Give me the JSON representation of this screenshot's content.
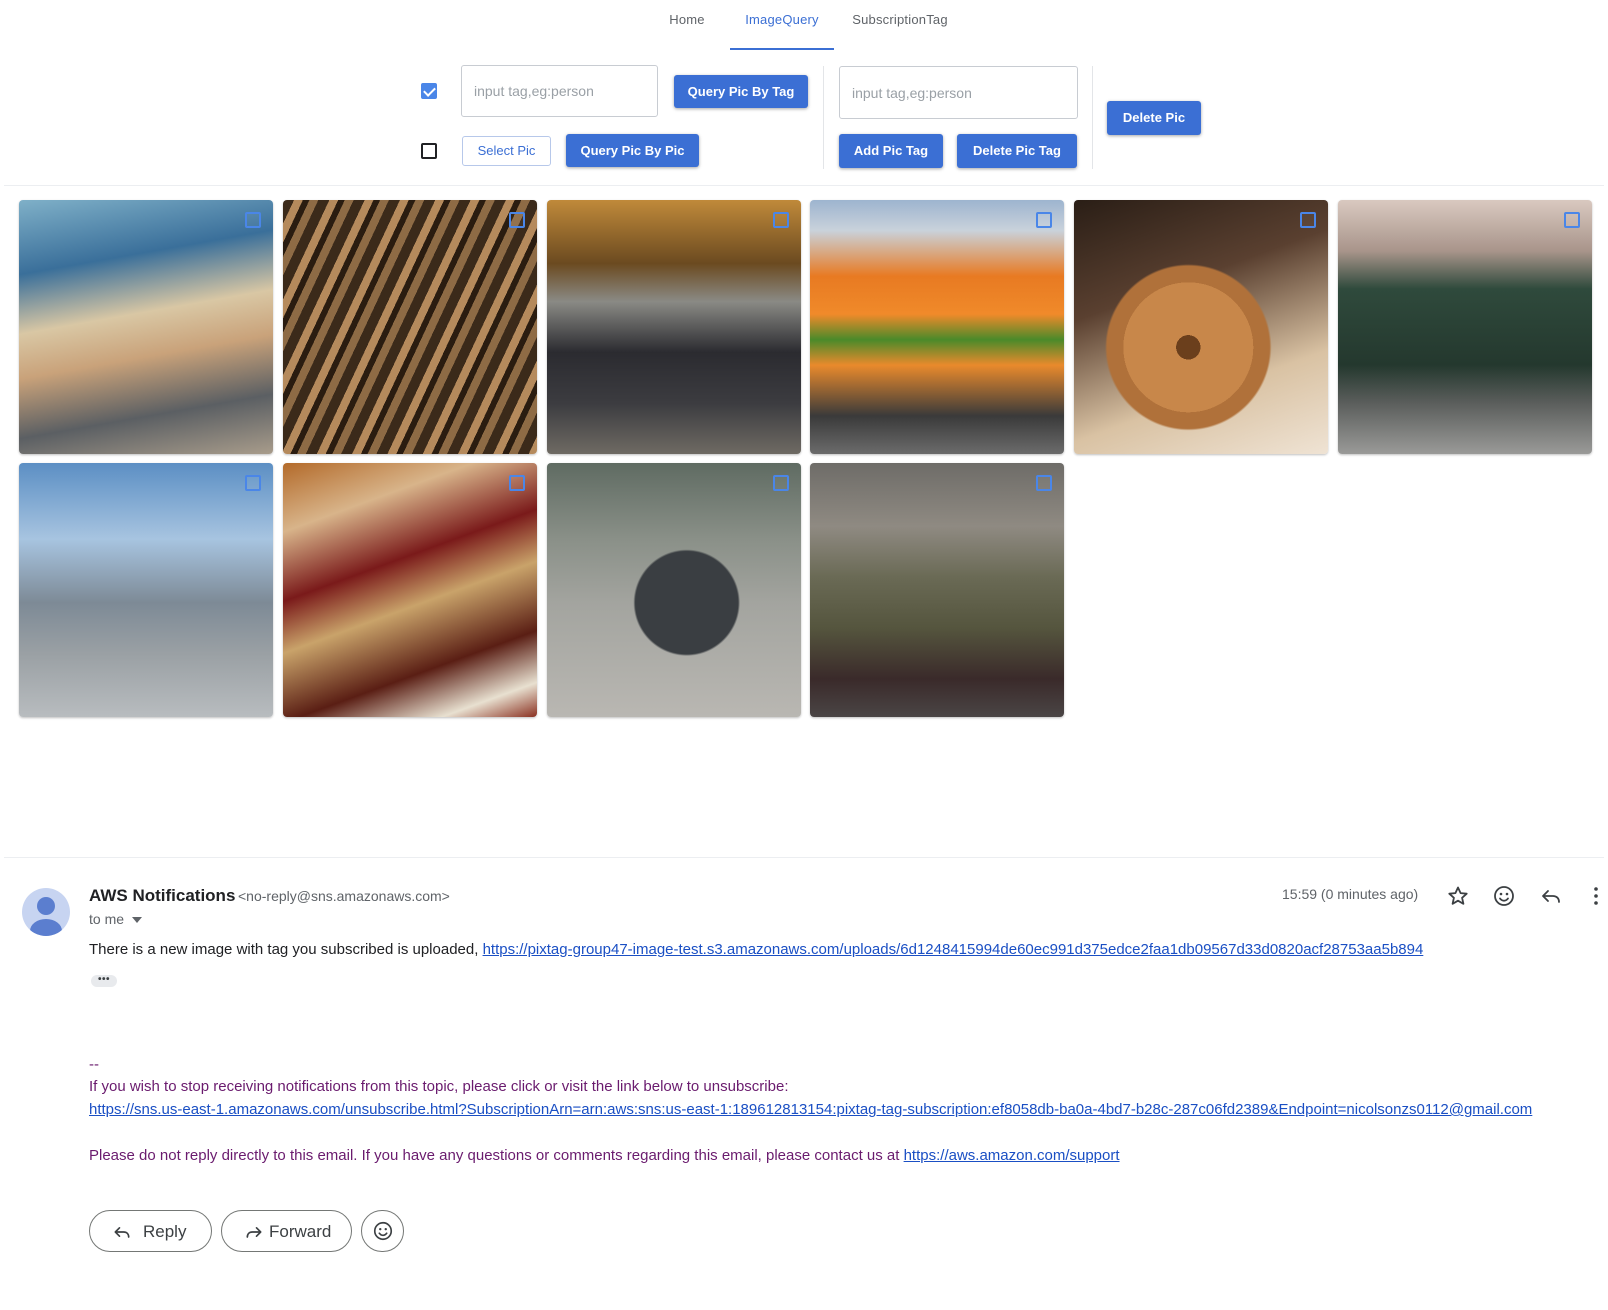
{
  "tabs": [
    "Home",
    "ImageQuery",
    "SubscriptionTag"
  ],
  "active_tab": "ImageQuery",
  "toolbar": {
    "query_by_tag_checked": true,
    "query_by_pic_checked": false,
    "tag_input_placeholder": "input tag,eg:person",
    "query_by_tag_button": "Query Pic By Tag",
    "select_pic_button": "Select Pic",
    "query_by_pic_button": "Query Pic By Pic",
    "pic_tag_input_placeholder": "input tag,eg:person",
    "add_pic_tag_button": "Add Pic Tag",
    "delete_pic_tag_button": "Delete Pic Tag",
    "delete_pic_button": "Delete Pic"
  },
  "gallery": {
    "images": [
      {
        "subject": "person on boat"
      },
      {
        "subject": "zebras"
      },
      {
        "subject": "man with umbrella"
      },
      {
        "subject": "orange van with bananas"
      },
      {
        "subject": "donut"
      },
      {
        "subject": "green bus"
      },
      {
        "subject": "skateboarder"
      },
      {
        "subject": "dinner table"
      },
      {
        "subject": "elephant"
      },
      {
        "subject": "man with motorcycle"
      }
    ]
  },
  "email": {
    "sender_name": "AWS Notifications",
    "sender_email": "<no-reply@sns.amazonaws.com>",
    "recipient": "to me",
    "time": "15:59 (0 minutes ago)",
    "message_prefix": "There is a new image with tag you subscribed is uploaded, ",
    "message_link": "https://pixtag-group47-image-test.s3.amazonaws.com/uploads/6d1248415994de60ec991d375edce2faa1db09567d33d0820acf28753aa5b894",
    "ellipsis": "•••",
    "signature_dash": "--",
    "unsubscribe_text": "If you wish to stop receiving notifications from this topic, please click or visit the link below to unsubscribe:",
    "unsubscribe_link": "https://sns.us-east-1.amazonaws.com/unsubscribe.html?SubscriptionArn=arn:aws:sns:us-east-1:189612813154:pixtag-tag-subscription:ef8058db-ba0a-4bd7-b28c-287c06fd2389&Endpoint=nicolsonzs0112@gmail.com",
    "no_reply_text": "Please do not reply directly to this email. If you have any questions or comments regarding this email, please contact us at ",
    "support_link": "https://aws.amazon.com/support",
    "reply_button": "Reply",
    "forward_button": "Forward"
  },
  "colors": {
    "accent": "#3b6fd4",
    "link": "#1a4fc4",
    "footer_text": "#6a1b6e"
  }
}
